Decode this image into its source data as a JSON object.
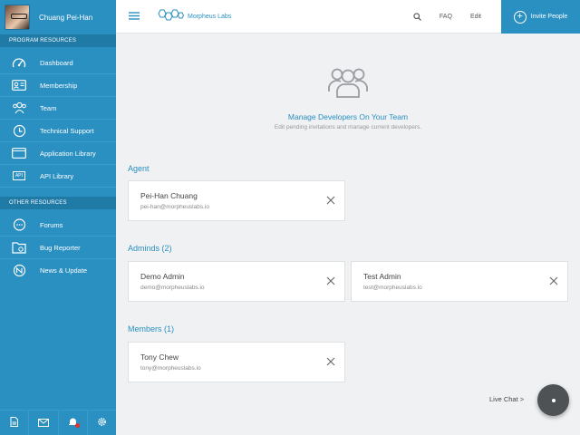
{
  "user": {
    "name": "Chuang Pei-Han"
  },
  "sidebar": {
    "program_heading": "PROGRAM RESOURCES",
    "program_items": [
      {
        "label": "Dashboard",
        "icon": "gauge-icon"
      },
      {
        "label": "Membership",
        "icon": "id-card-icon"
      },
      {
        "label": "Team",
        "icon": "team-icon"
      },
      {
        "label": "Technical Support",
        "icon": "support-icon"
      },
      {
        "label": "Application Library",
        "icon": "window-icon"
      },
      {
        "label": "API Library",
        "icon": "api-icon"
      }
    ],
    "api_icon_text": "API",
    "other_heading": "OTHER RESOURCES",
    "other_items": [
      {
        "label": "Forums",
        "icon": "chat-bubble-icon"
      },
      {
        "label": "Bug Reporter",
        "icon": "bug-report-icon"
      },
      {
        "label": "News & Update",
        "icon": "news-icon"
      }
    ],
    "bottom_icons": [
      "document-icon",
      "mail-icon",
      "bell-icon",
      "gear-icon"
    ]
  },
  "header": {
    "brand": "Morpheus Labs",
    "faq": "FAQ",
    "edit": "Edit",
    "invite": "Invite People"
  },
  "hero": {
    "title": "Manage Developers On Your Team",
    "subtitle": "Edit pending invitations and manage current developers."
  },
  "sections": {
    "agent": {
      "title": "Agent",
      "people": [
        {
          "name": "Pei-Han Chuang",
          "email": "pei-han@morpheuslabs.io"
        }
      ]
    },
    "admins": {
      "title": "Adminds (2)",
      "people": [
        {
          "name": "Demo Admin",
          "email": "demo@morpheuslabs.io"
        },
        {
          "name": "Test Admin",
          "email": "test@morpheuslabs.io"
        }
      ]
    },
    "members": {
      "title": "Members (1)",
      "people": [
        {
          "name": "Tony Chew",
          "email": "tony@morpheuslabs.io"
        }
      ]
    }
  },
  "live_chat": "Live Chat >",
  "colors": {
    "accent": "#2a8fc1",
    "sidebar": "#2a8fc1",
    "section_head": "#1f7aa6",
    "notification": "#e0332a"
  }
}
